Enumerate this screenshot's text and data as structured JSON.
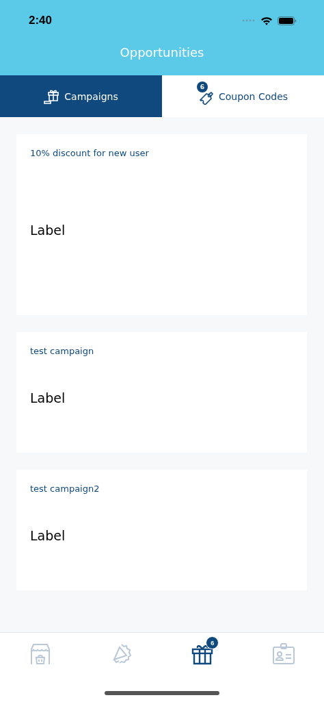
{
  "status_bar": {
    "time": "2:40"
  },
  "header": {
    "title": "Opportunities"
  },
  "tabs": [
    {
      "label": "Campaigns",
      "selected": true
    },
    {
      "label": "Coupon Codes",
      "selected": false,
      "badge": "6"
    }
  ],
  "cards": [
    {
      "title": "10% discount for new user",
      "label": "Label"
    },
    {
      "title": "test campaign",
      "label": "Label"
    },
    {
      "title": "test campaign2",
      "label": "Label"
    }
  ],
  "bottom_nav": [
    {
      "selected": false
    },
    {
      "selected": false
    },
    {
      "selected": true,
      "badge": "6"
    },
    {
      "selected": false
    }
  ]
}
